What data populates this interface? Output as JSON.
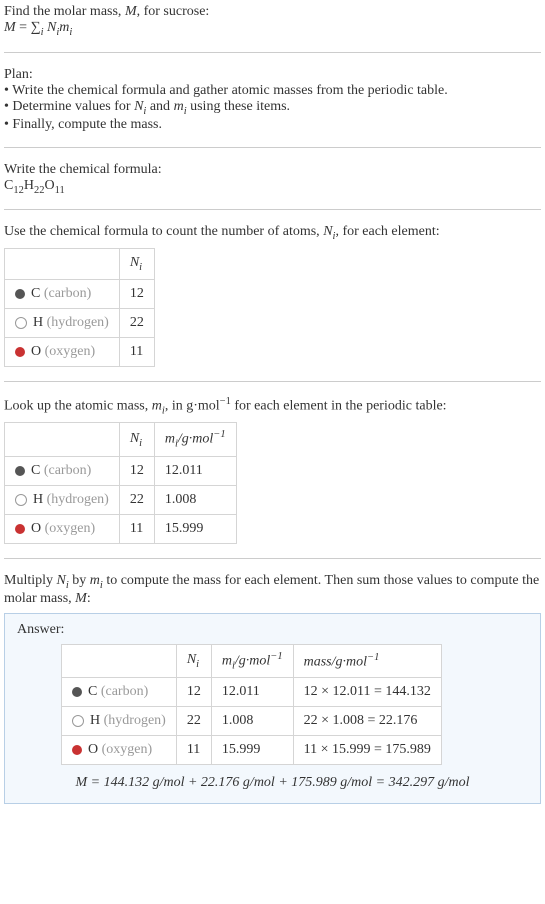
{
  "intro": {
    "line1_before": "Find the molar mass, ",
    "line1_mid": "M",
    "line1_after": ", for sucrose:",
    "formula": "M = ∑",
    "sigma_sub": "i",
    "formula_after": " Nᵢmᵢ",
    "M": "M",
    "Ni": "N",
    "mi": "m"
  },
  "plan": {
    "title": "Plan:",
    "b1a": "• Write the chemical formula and gather atomic masses from the periodic table.",
    "b2a": "• Determine values for ",
    "b2b": " and ",
    "b2c": " using these items.",
    "b3": "• Finally, compute the mass."
  },
  "step2": {
    "line1": "Write the chemical formula:",
    "cf": "C₁₂H₂₂O₁₁",
    "cfC": "C",
    "cf12": "12",
    "cfH": "H",
    "cf22": "22",
    "cfO": "O",
    "cf11": "11"
  },
  "step3": {
    "line": "Use the chemical formula to count the number of atoms, Nᵢ, for each element:",
    "line_a": "Use the chemical formula to count the number of atoms, ",
    "line_b": ", for each element:"
  },
  "tableA": {
    "h_Ni": "N",
    "rows": [
      {
        "sym": "C",
        "name": "(carbon)",
        "n": "12",
        "b": "b-c"
      },
      {
        "sym": "H",
        "name": "(hydrogen)",
        "n": "22",
        "b": "b-h"
      },
      {
        "sym": "O",
        "name": "(oxygen)",
        "n": "11",
        "b": "b-o"
      }
    ]
  },
  "step4": {
    "a": "Look up the atomic mass, ",
    "b": ", in g·mol",
    "c": " for each element in the periodic table:"
  },
  "tableB": {
    "h_Ni": "N",
    "h_mi": "m",
    "h_unit": "/g·mol",
    "rows": [
      {
        "sym": "C",
        "name": "(carbon)",
        "n": "12",
        "m": "12.011",
        "b": "b-c"
      },
      {
        "sym": "H",
        "name": "(hydrogen)",
        "n": "22",
        "m": "1.008",
        "b": "b-h"
      },
      {
        "sym": "O",
        "name": "(oxygen)",
        "n": "11",
        "m": "15.999",
        "b": "b-o"
      }
    ]
  },
  "step5": {
    "a": "Multiply ",
    "b": " by ",
    "c": " to compute the mass for each element. Then sum those values to compute the molar mass, ",
    "d": ":"
  },
  "answer": {
    "label": "Answer:",
    "h_Ni": "N",
    "h_mi": "m",
    "h_unit": "/g·mol",
    "h_mass": "mass/g·mol",
    "rows": [
      {
        "sym": "C",
        "name": "(carbon)",
        "n": "12",
        "m": "12.011",
        "mass": "12 × 12.011 = 144.132",
        "b": "b-c"
      },
      {
        "sym": "H",
        "name": "(hydrogen)",
        "n": "22",
        "m": "1.008",
        "mass": "22 × 1.008 = 22.176",
        "b": "b-h"
      },
      {
        "sym": "O",
        "name": "(oxygen)",
        "n": "11",
        "m": "15.999",
        "mass": "11 × 15.999 = 175.989",
        "b": "b-o"
      }
    ],
    "final": "M = 144.132 g/mol + 22.176 g/mol + 175.989 g/mol = 342.297 g/mol"
  }
}
